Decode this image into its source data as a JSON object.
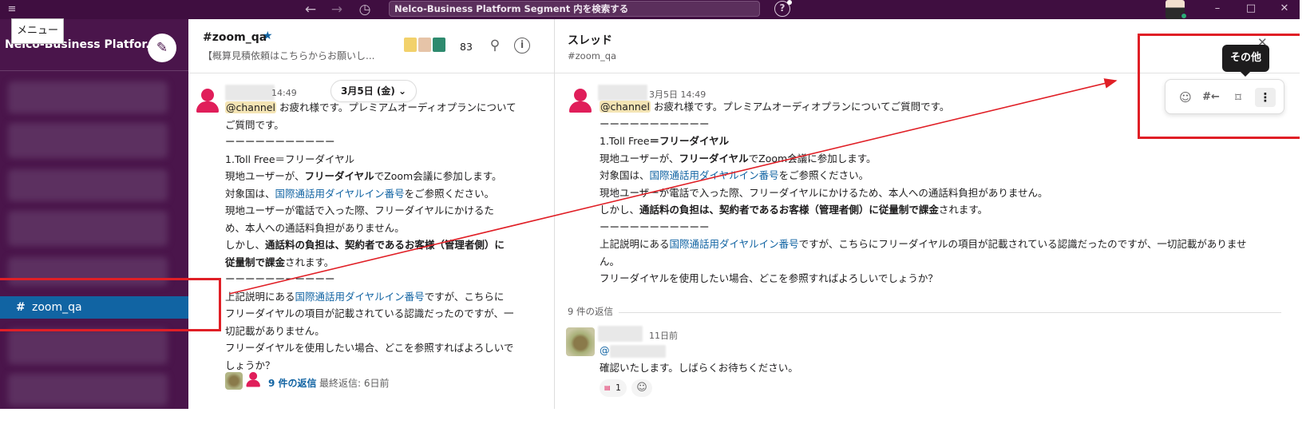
{
  "topbar": {
    "search_placeholder": "Nelco-Business Platform Segment 内を検索する",
    "menu_tooltip": "メニュー"
  },
  "sidebar": {
    "workspace_name": "Nelco-Business Platfor...",
    "active_channel_hash": "#",
    "active_channel": "zoom_qa"
  },
  "channel": {
    "title": "#zoom_qa",
    "topic": "【概算見積依頼はこちらからお願いし...",
    "member_count": "83",
    "date_pill": "3月5日 (金) ⌄",
    "message": {
      "time": "14:49",
      "mention": "@channel",
      "l1_rest": " お疲れ様です。プレミアムオーディオプランについて",
      "l2": "ご質問です。",
      "sep": "ーーーーーーーーーーー",
      "item_title": "1.Toll Free＝フリーダイヤル",
      "l4_pre": "現地ユーザーが、",
      "l4_bold": "フリーダイヤル",
      "l4_post": "でZoom会議に参加します。",
      "l5_pre": "対象国は、",
      "l5_link": "国際通話用ダイヤルイン番号",
      "l5_post": "をご参照ください。",
      "l6": "現地ユーザーが電話で入った際、フリーダイヤルにかけるた",
      "l7": "め、本人への通話料負担がありません。",
      "l8_pre": "しかし、",
      "l8_bold": "通話料の負担は、契約者であるお客様（管理者側）に",
      "l9_bold": "従量制で課金",
      "l9_post": "されます。",
      "sep2": "ーーーーーーーーーーー",
      "l10_pre": "上記説明にある",
      "l10_link": "国際通話用ダイヤルイン番号",
      "l10_post": "ですが、こちらに",
      "l11": "フリーダイヤルの項目が記載されている認識だったのですが、一",
      "l12": "切記載がありません。",
      "l13": "フリーダイヤルを使用したい場合、どこを参照すればよろしいで",
      "l14": "しょうか？",
      "reply_count": "9 件の返信",
      "reply_last": "最終返信: 6日前"
    }
  },
  "thread": {
    "title": "スレッド",
    "subtitle": "#zoom_qa",
    "close": "✕",
    "parent": {
      "time": "3月5日 14:49",
      "mention": "@channel",
      "l1_rest": " お疲れ様です。プレミアムオーディオプランについてご質問です。",
      "sep": "ーーーーーーーーーーー",
      "item_title_pre": "1.Toll Free",
      "item_title_bold": "＝フリーダイヤル",
      "l3_pre": "現地ユーザーが、",
      "l3_bold": "フリーダイヤル",
      "l3_post": "でZoom会議に参加します。",
      "l4_pre": "対象国は、",
      "l4_link": "国際通話用ダイヤルイン番号",
      "l4_post": "をご参照ください。",
      "l5": "現地ユーザーが電話で入った際、フリーダイヤルにかけるため、本人への通話料負担がありません。",
      "l6_pre": "しかし、",
      "l6_bold": "通話料の負担は、契約者であるお客様（管理者側）に従量制で課金",
      "l6_post": "されます。",
      "sep2": "ーーーーーーーーーーー",
      "l7_pre": "上記説明にある",
      "l7_link": "国際通話用ダイヤルイン番号",
      "l7_post": "ですが、こちらにフリーダイヤルの項目が記載されている認識だったのですが、一切記載がありませ",
      "l8": "ん。",
      "l9": "フリーダイヤルを使用したい場合、どこを参照すればよろしいでしょうか？"
    },
    "replies_label": "9 件の返信",
    "reply": {
      "time": "11日前",
      "mention": "@",
      "text": "確認いたします。しばらくお待ちください。",
      "reaction_count": "1"
    }
  },
  "actions": {
    "tooltip": "その他",
    "add_reaction": "☺",
    "share": "#←",
    "bookmark": "⌑",
    "more": "⋮"
  },
  "annotation": {
    "color": "#e01f26"
  }
}
